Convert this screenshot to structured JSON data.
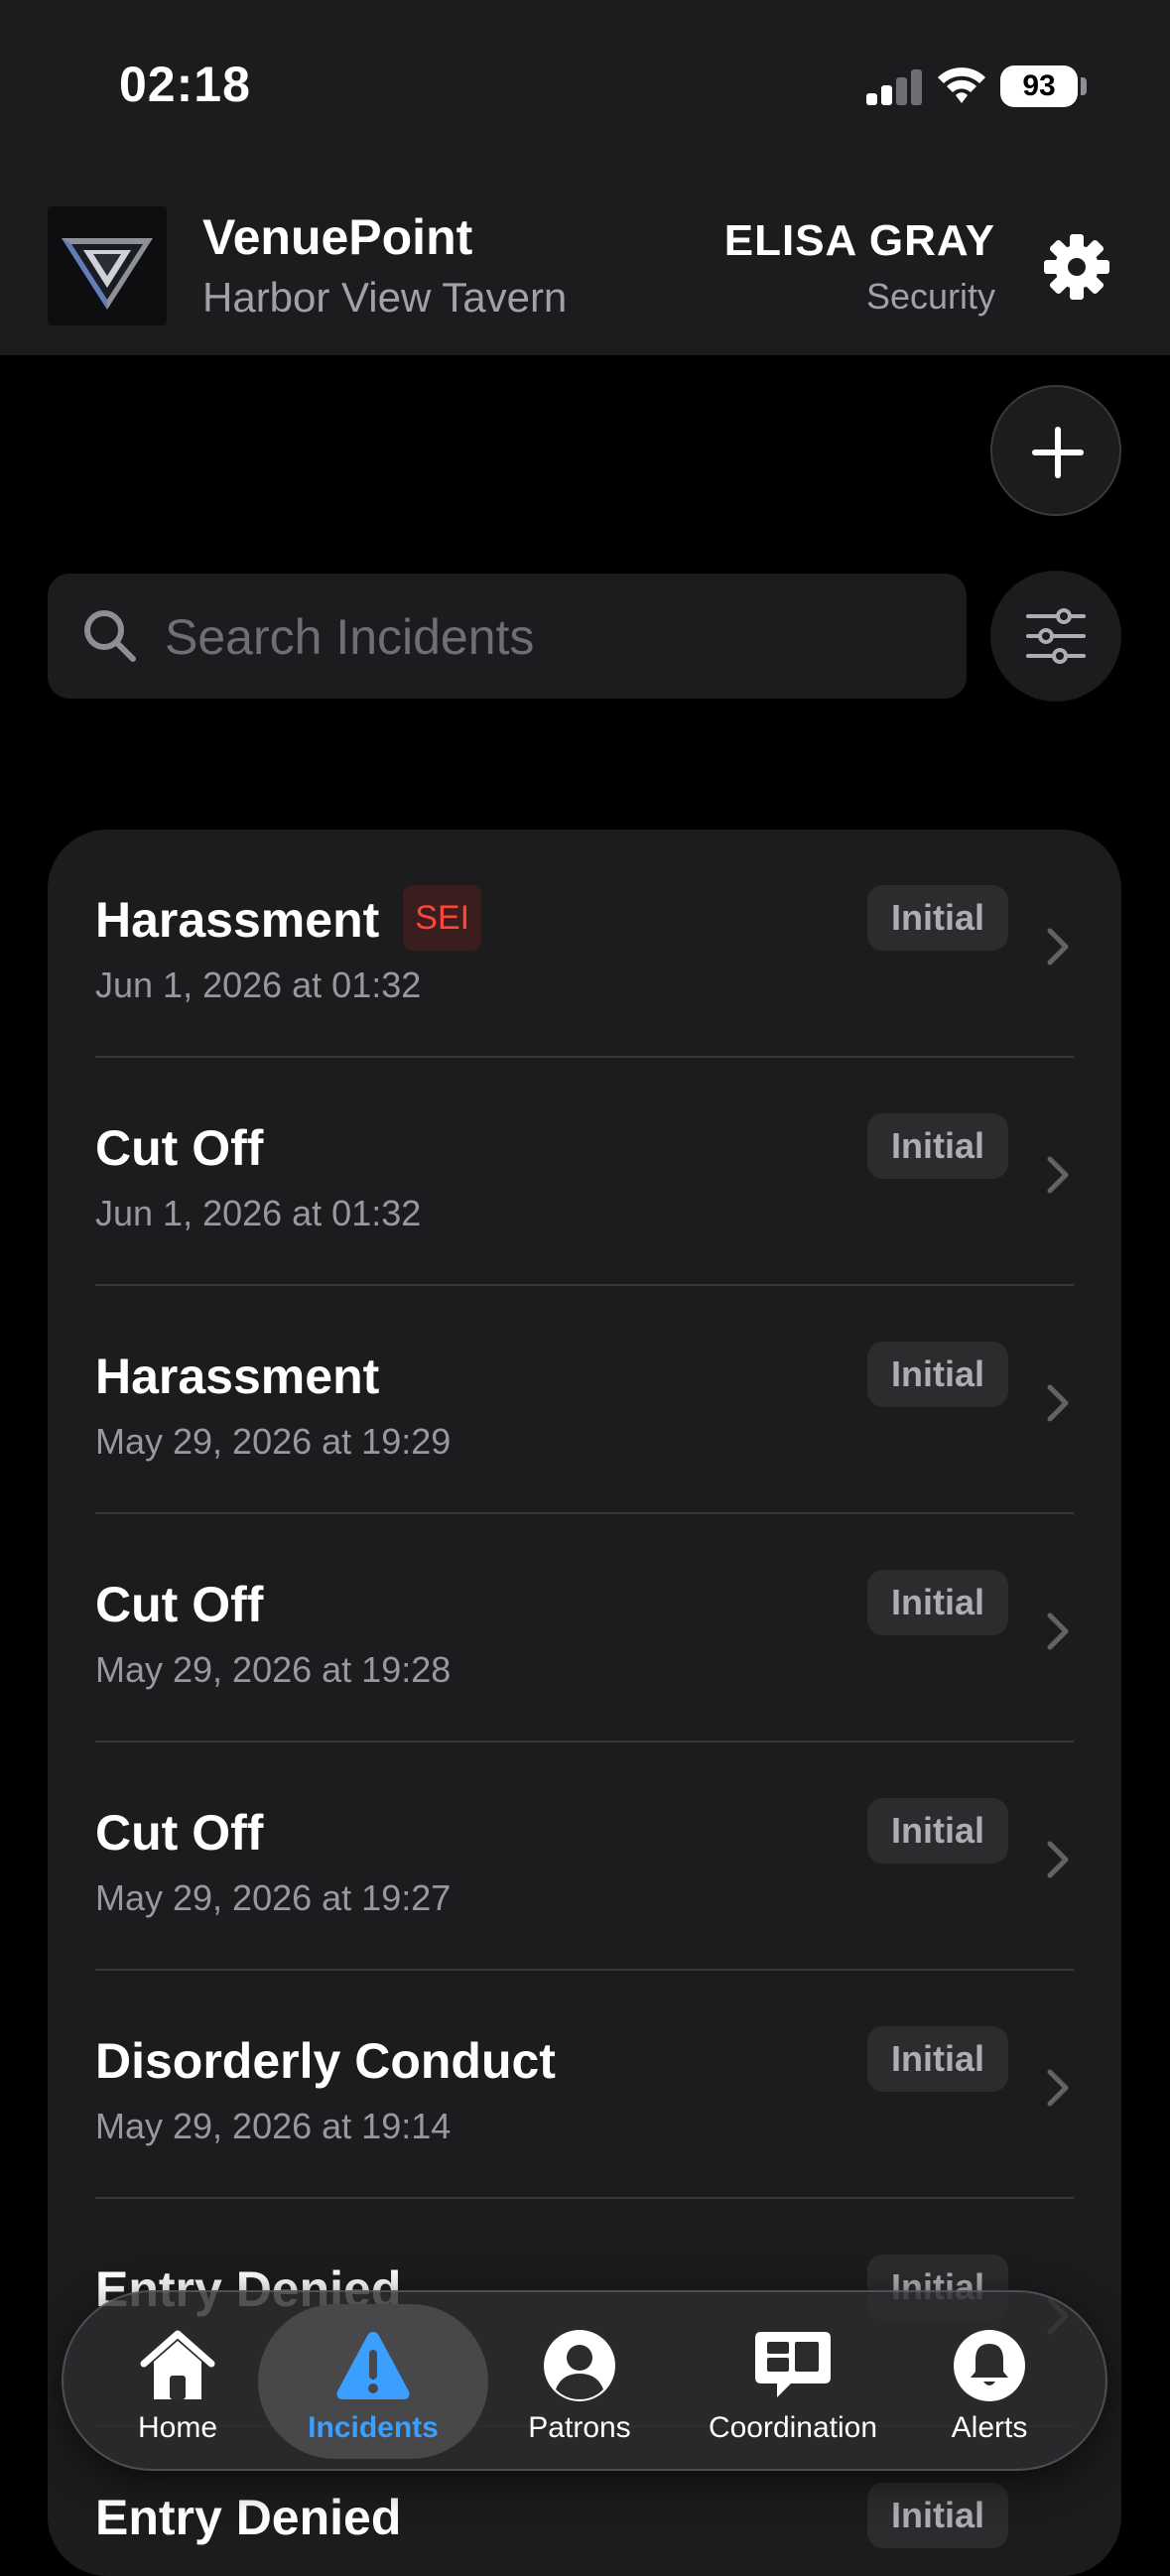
{
  "status_bar": {
    "time": "02:18",
    "battery": "93"
  },
  "header": {
    "app_name": "VenuePoint",
    "venue": "Harbor View Tavern",
    "user_name": "ELISA GRAY",
    "user_role": "Security"
  },
  "search": {
    "placeholder": "Search Incidents",
    "value": ""
  },
  "incidents": [
    {
      "title": "Harassment",
      "badge": "SEI",
      "date": "Jun 1, 2026 at 01:32",
      "status": "Initial"
    },
    {
      "title": "Cut Off",
      "date": "Jun 1, 2026 at 01:32",
      "status": "Initial"
    },
    {
      "title": "Harassment",
      "date": "May 29, 2026 at 19:29",
      "status": "Initial"
    },
    {
      "title": "Cut Off",
      "date": "May 29, 2026 at 19:28",
      "status": "Initial"
    },
    {
      "title": "Cut Off",
      "date": "May 29, 2026 at 19:27",
      "status": "Initial"
    },
    {
      "title": "Disorderly Conduct",
      "date": "May 29, 2026 at 19:14",
      "status": "Initial"
    },
    {
      "title": "Entry Denied",
      "date": "",
      "status": "Initial"
    },
    {
      "title": "Entry Denied",
      "date": "",
      "status": "Initial"
    }
  ],
  "tabs": [
    {
      "label": "Home",
      "icon": "house-icon"
    },
    {
      "label": "Incidents",
      "icon": "warning-triangle-icon",
      "active": true
    },
    {
      "label": "Patrons",
      "icon": "person-circle-icon"
    },
    {
      "label": "Coordination",
      "icon": "chat-bubble-icon"
    },
    {
      "label": "Alerts",
      "icon": "bell-icon"
    }
  ],
  "colors": {
    "background": "#000000",
    "surface": "#1c1c1e",
    "accent": "#3a9fff",
    "sei_badge": "#ff453a",
    "secondary_text": "#98989d"
  }
}
